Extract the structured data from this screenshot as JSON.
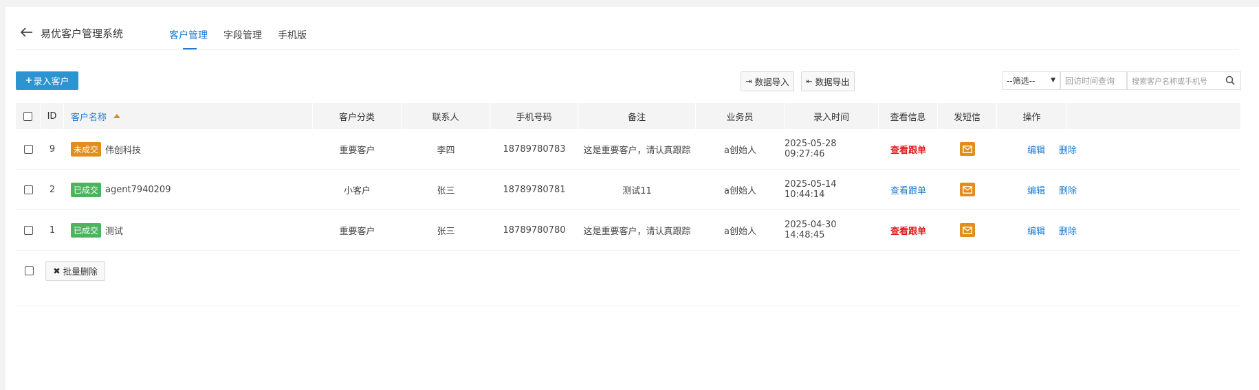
{
  "header": {
    "title": "易优客户管理系统",
    "tabs": [
      {
        "label": "客户管理",
        "active": true
      },
      {
        "label": "字段管理",
        "active": false
      },
      {
        "label": "手机版",
        "active": false
      }
    ]
  },
  "toolbar": {
    "add_label": "录入客户",
    "import_label": "数据导入",
    "export_label": "数据导出",
    "filter_selected": "--筛选--",
    "visit_time_placeholder": "回访时间查询",
    "search_placeholder": "搜索客户名称或手机号"
  },
  "table": {
    "columns": [
      "ID",
      "客户名称",
      "客户分类",
      "联系人",
      "手机号码",
      "备注",
      "业务员",
      "录入时间",
      "查看信息",
      "发短信",
      "操作"
    ],
    "rows": [
      {
        "id": "9",
        "status": "未成交",
        "status_type": "pending",
        "name": "伟创科技",
        "category": "重要客户",
        "contact": "李四",
        "phone": "18789780783",
        "note": "这是重要客户，请认真跟踪",
        "salesman": "a创始人",
        "time": "2025-05-28 09:27:46",
        "view_label": "查看跟单",
        "view_style": "red",
        "edit": "编辑",
        "delete": "删除"
      },
      {
        "id": "2",
        "status": "已成交",
        "status_type": "done",
        "name": "agent7940209",
        "category": "小客户",
        "contact": "张三",
        "phone": "18789780781",
        "note": "测试11",
        "salesman": "a创始人",
        "time": "2025-05-14 10:44:14",
        "view_label": "查看跟单",
        "view_style": "blue",
        "edit": "编辑",
        "delete": "删除"
      },
      {
        "id": "1",
        "status": "已成交",
        "status_type": "done",
        "name": "测试",
        "category": "重要客户",
        "contact": "张三",
        "phone": "18789780780",
        "note": "这是重要客户，请认真跟踪",
        "salesman": "a创始人",
        "time": "2025-04-30 14:48:45",
        "view_label": "查看跟单",
        "view_style": "red",
        "edit": "编辑",
        "delete": "删除"
      }
    ]
  },
  "footer": {
    "batch_delete_label": "批量删除"
  },
  "colors": {
    "primary": "#2d94d2",
    "link": "#1e7ad0",
    "pending": "#e38e1c",
    "done": "#4cb45f",
    "alert": "#e01b1b"
  }
}
